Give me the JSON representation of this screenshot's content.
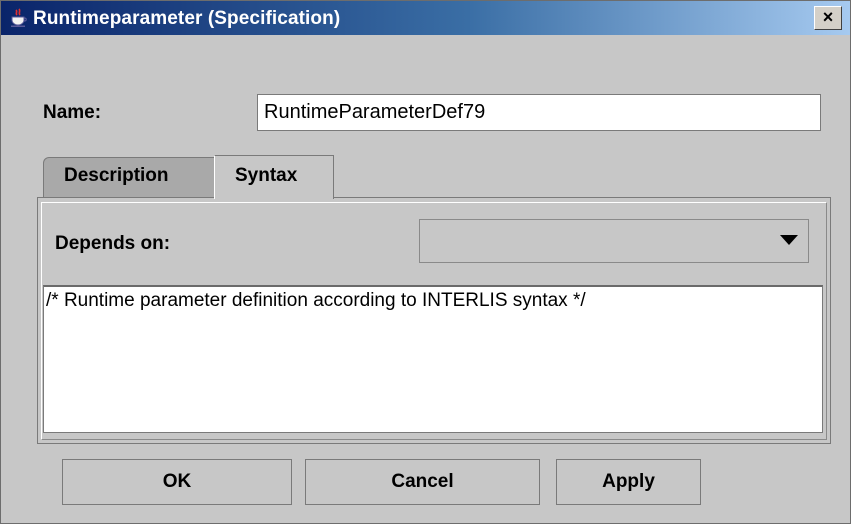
{
  "window": {
    "title": "Runtimeparameter (Specification)",
    "icon": "java-cup-icon",
    "close_label": "×"
  },
  "name_field": {
    "label": "Name:",
    "value": "RuntimeParameterDef79"
  },
  "tabs": [
    {
      "label": "Description",
      "selected": false
    },
    {
      "label": "Syntax",
      "selected": true
    }
  ],
  "syntax_tab": {
    "depends_label": "Depends on:",
    "depends_value": "",
    "syntax_text": "/* Runtime parameter definition according to INTERLIS syntax */"
  },
  "buttons": {
    "ok": "OK",
    "cancel": "Cancel",
    "apply": "Apply"
  }
}
